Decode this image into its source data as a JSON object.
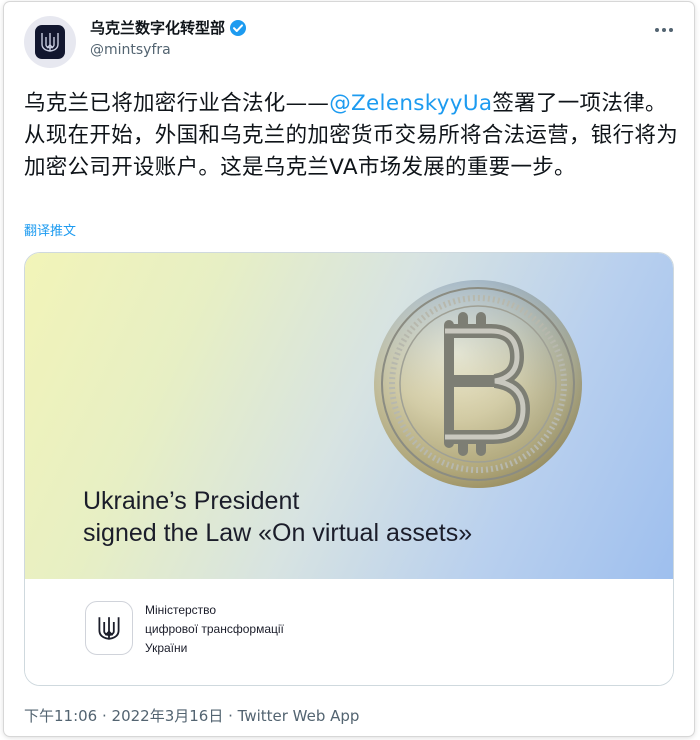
{
  "author": {
    "display_name": "乌克兰数字化转型部",
    "handle": "@mintsyfra",
    "verified": true
  },
  "tweet": {
    "text_before": "乌克兰已将加密行业合法化——",
    "mention": "@ZelenskyyUa",
    "text_after": "签署了一项法律。从现在开始，外国和乌克兰的加密货币交易所将合法运营，银行将为加密公司开设账户。这是乌克兰VA市场发展的重要一步。",
    "translate_label": "翻译推文"
  },
  "card": {
    "caption_line1": "Ukraine’s President",
    "caption_line2": "signed the Law «On virtual assets»",
    "ministry_line1": "Міністерство",
    "ministry_line2": "цифрової трансформації",
    "ministry_line3": "України"
  },
  "meta": {
    "timestamp": "下午11:06 · 2022年3月16日 · Twitter Web App"
  },
  "colors": {
    "accent": "#1d9bf0",
    "text": "#0f1419",
    "secondary": "#536471"
  },
  "icons": {
    "verified": "verified-badge-icon",
    "more": "more-horizontal-icon",
    "logo": "trident-icon",
    "coin": "bitcoin-icon"
  }
}
